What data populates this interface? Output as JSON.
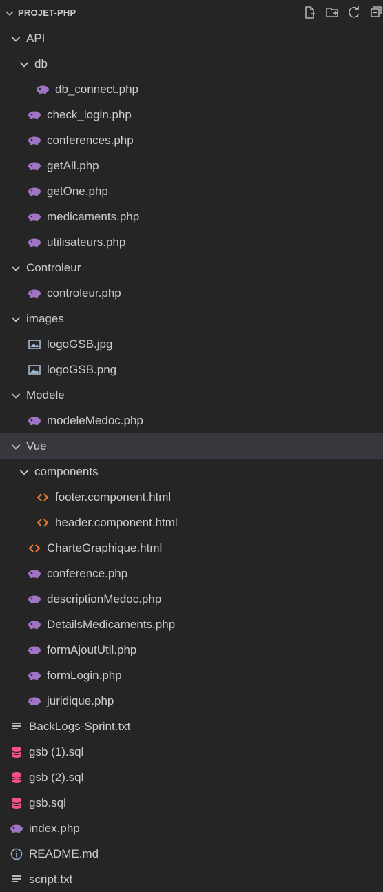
{
  "explorer": {
    "title": "PROJET-PHP",
    "actions": [
      "new-file-icon",
      "new-folder-icon",
      "refresh-icon",
      "collapse-all-icon"
    ]
  },
  "tree": [
    {
      "label": "API",
      "type": "folder",
      "level": 1
    },
    {
      "label": "db",
      "type": "folder",
      "level": 2
    },
    {
      "label": "db_connect.php",
      "type": "php",
      "level": 3
    },
    {
      "label": "check_login.php",
      "type": "php",
      "level": 2
    },
    {
      "label": "conferences.php",
      "type": "php",
      "level": 2
    },
    {
      "label": "getAll.php",
      "type": "php",
      "level": 2
    },
    {
      "label": "getOne.php",
      "type": "php",
      "level": 2
    },
    {
      "label": "medicaments.php",
      "type": "php",
      "level": 2
    },
    {
      "label": "utilisateurs.php",
      "type": "php",
      "level": 2
    },
    {
      "label": "Controleur",
      "type": "folder",
      "level": 1
    },
    {
      "label": "controleur.php",
      "type": "php",
      "level": 2
    },
    {
      "label": "images",
      "type": "folder",
      "level": 1
    },
    {
      "label": "logoGSB.jpg",
      "type": "image",
      "level": 2
    },
    {
      "label": "logoGSB.png",
      "type": "image",
      "level": 2
    },
    {
      "label": "Modele",
      "type": "folder",
      "level": 1
    },
    {
      "label": "modeleMedoc.php",
      "type": "php",
      "level": 2
    },
    {
      "label": "Vue",
      "type": "folder",
      "level": 1,
      "selected": true
    },
    {
      "label": "components",
      "type": "folder",
      "level": 2
    },
    {
      "label": "footer.component.html",
      "type": "html",
      "level": 3
    },
    {
      "label": "header.component.html",
      "type": "html",
      "level": 3
    },
    {
      "label": "CharteGraphique.html",
      "type": "html",
      "level": 2
    },
    {
      "label": "conference.php",
      "type": "php",
      "level": 2
    },
    {
      "label": "descriptionMedoc.php",
      "type": "php",
      "level": 2
    },
    {
      "label": "DetailsMedicaments.php",
      "type": "php",
      "level": 2
    },
    {
      "label": "formAjoutUtil.php",
      "type": "php",
      "level": 2
    },
    {
      "label": "formLogin.php",
      "type": "php",
      "level": 2
    },
    {
      "label": "juridique.php",
      "type": "php",
      "level": 2
    },
    {
      "label": "BackLogs-Sprint.txt",
      "type": "txt",
      "level": 1
    },
    {
      "label": "gsb (1).sql",
      "type": "sql",
      "level": 1
    },
    {
      "label": "gsb (2).sql",
      "type": "sql",
      "level": 1
    },
    {
      "label": "gsb.sql",
      "type": "sql",
      "level": 1
    },
    {
      "label": "index.php",
      "type": "php",
      "level": 1
    },
    {
      "label": "README.md",
      "type": "info",
      "level": 1
    },
    {
      "label": "script.txt",
      "type": "txt",
      "level": 1
    }
  ],
  "colors": {
    "background": "#252526",
    "selected_row": "#37373d",
    "php_icon": "#a074c4",
    "html_icon": "#e37933",
    "sql_icon": "#f55385",
    "image_icon": "#a4b7d2",
    "info_icon": "#9bb5d8"
  }
}
